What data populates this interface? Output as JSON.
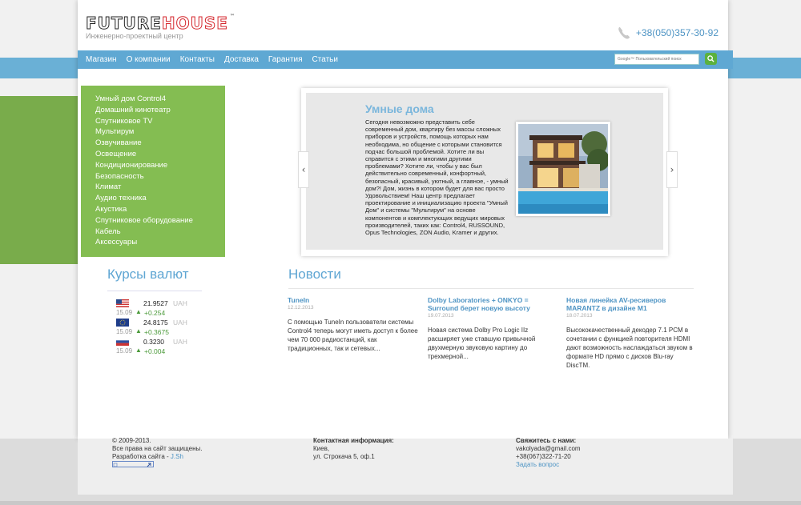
{
  "header": {
    "logo_future": "FUTURE",
    "logo_house": "HOUSE",
    "logo_tm": "™",
    "tagline": "Инженерно-проектный центр",
    "phone": "+38(050)357-30-92"
  },
  "nav": {
    "items": [
      "Магазин",
      "О компании",
      "Контакты",
      "Доставка",
      "Гарантия",
      "Статьи"
    ],
    "search_placeholder": "Google™ Пользовательский поиск"
  },
  "side_menu": {
    "items": [
      "Умный дом Control4",
      "Домашний кинотеатр",
      "Спутниковое TV",
      "Мультирум",
      "Озвучивание",
      "Освещение",
      "Кондиционирование",
      "Безопасность",
      "Климат",
      "Аудио техника",
      "Акустика",
      "Спутниковое оборудование",
      "Кабель",
      "Аксессуары"
    ]
  },
  "slider": {
    "title": "Умные дома",
    "text": "Сегодня невозможно представить себе современный дом, квартиру без массы сложных приборов и устройств, помощь которых нам необходима, но общение с которыми становится подчас большой проблемой. Хотите ли вы справится с этими и многими другими проблемами? Хотите ли, чтобы у вас был действительно современный, конфортный, безопасный, красивый, уютный, а главное, - умный дом?! Дом, жизнь в котором будет для вас просто Удовольствием! Наш центр предлагает проектирование и инициализацию проекта \"Умный Дом\" и системы \"Мультирум\" на основе компонентов и комплектующих ведущих мировых производителей, таких как: Control4, RUSSOUND, Opus Technologies, ZON Audio, Kramer и других.",
    "prev": "‹",
    "next": "›"
  },
  "currency": {
    "title": "Курсы валют",
    "rows": [
      {
        "date": "15.09",
        "rate": "21.9527",
        "unit": "UAH",
        "delta": "+0.254"
      },
      {
        "date": "15.09",
        "rate": "24.8175",
        "unit": "UAH",
        "delta": "+0.3675"
      },
      {
        "date": "15.09",
        "rate": "0.3230",
        "unit": "UAH",
        "delta": "+0.004"
      }
    ]
  },
  "news": {
    "title": "Новости",
    "items": [
      {
        "head": "TuneIn",
        "date": "12.12.2013",
        "body": "С помощью TuneIn пользователи системы Control4 теперь могут иметь доступ к более чем 70 000 радиостанций, как традиционных, так и сетевых..."
      },
      {
        "head": "Dolby Laboratories + ONKYO = Surround берет новую высоту",
        "date": "19.07.2013",
        "body": "Новая система Dolby Pro Logic IIz расширяет уже ставшую привычной двухмерную звуковую картину до трехмерной..."
      },
      {
        "head": "Новая линейка AV-ресиверов MARANTZ в дизайне M1",
        "date": "18.07.2013",
        "body": "Высококачественный декодер 7.1 PCM в сочетании с функцией повторителя HDMI дают возможность наслаждаться звуком в формате HD прямо с дисков Blu-ray DiscTM."
      }
    ]
  },
  "footer": {
    "copyright": "© 2009-2013.",
    "rights": "Все права на сайт защищены.",
    "dev_prefix": "Разработка сайта - ",
    "dev_link": "J.Sh",
    "contact_title": "Контактная информация:",
    "city": "Киев,",
    "address": "ул. Строкача 5, оф.1",
    "connect_title": "Свяжитесь с нами:",
    "email": "vakolyada@gmail.com",
    "phone": "+38(067)322-71-20",
    "ask": "Задать вопрос"
  }
}
